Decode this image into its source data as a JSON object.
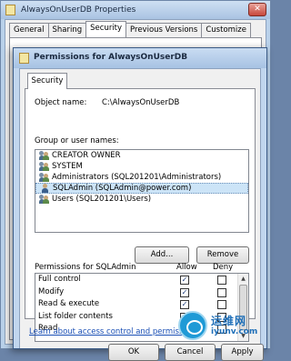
{
  "background_window": {
    "title": "AlwaysOnUserDB Properties",
    "close_glyph": "✕",
    "tabs": [
      "General",
      "Sharing",
      "Security",
      "Previous Versions",
      "Customize"
    ],
    "active_tab": "Security",
    "fragments": {
      "g": "G",
      "t1": "T",
      "t2": "T",
      "l": "L"
    }
  },
  "dialog": {
    "title": "Permissions for AlwaysOnUserDB",
    "tab": "Security",
    "object_name_label": "Object name:",
    "object_name_value": "C:\\AlwaysOnUserDB",
    "group_label": "Group or user names:",
    "users": [
      {
        "name": "CREATOR OWNER",
        "icon": "group-icon",
        "selected": false
      },
      {
        "name": "SYSTEM",
        "icon": "group-icon",
        "selected": false
      },
      {
        "name": "Administrators (SQL201201\\Administrators)",
        "icon": "group-icon",
        "selected": false
      },
      {
        "name": "SQLAdmin (SQLAdmin@power.com)",
        "icon": "user-icon",
        "selected": true
      },
      {
        "name": "Users (SQL201201\\Users)",
        "icon": "group-icon",
        "selected": false
      }
    ],
    "add_button": "Add...",
    "remove_button": "Remove",
    "permissions_label": "Permissions for SQLAdmin",
    "allow_header": "Allow",
    "deny_header": "Deny",
    "permissions": [
      {
        "name": "Full control",
        "allow": true,
        "deny": false
      },
      {
        "name": "Modify",
        "allow": true,
        "deny": false
      },
      {
        "name": "Read & execute",
        "allow": true,
        "deny": false
      },
      {
        "name": "List folder contents",
        "allow": true,
        "deny": false
      },
      {
        "name": "Read",
        "allow": true,
        "deny": false
      }
    ],
    "learn_link": "Learn about access control and permissions",
    "ok_button": "OK",
    "cancel_button": "Cancel",
    "apply_button": "Apply"
  },
  "watermark": {
    "cn": "运维网",
    "en": "iyunv.com"
  },
  "colors": {
    "selection": "#cce4f7",
    "link": "#1a4fb5",
    "title_bar": "#c1d6ee"
  }
}
